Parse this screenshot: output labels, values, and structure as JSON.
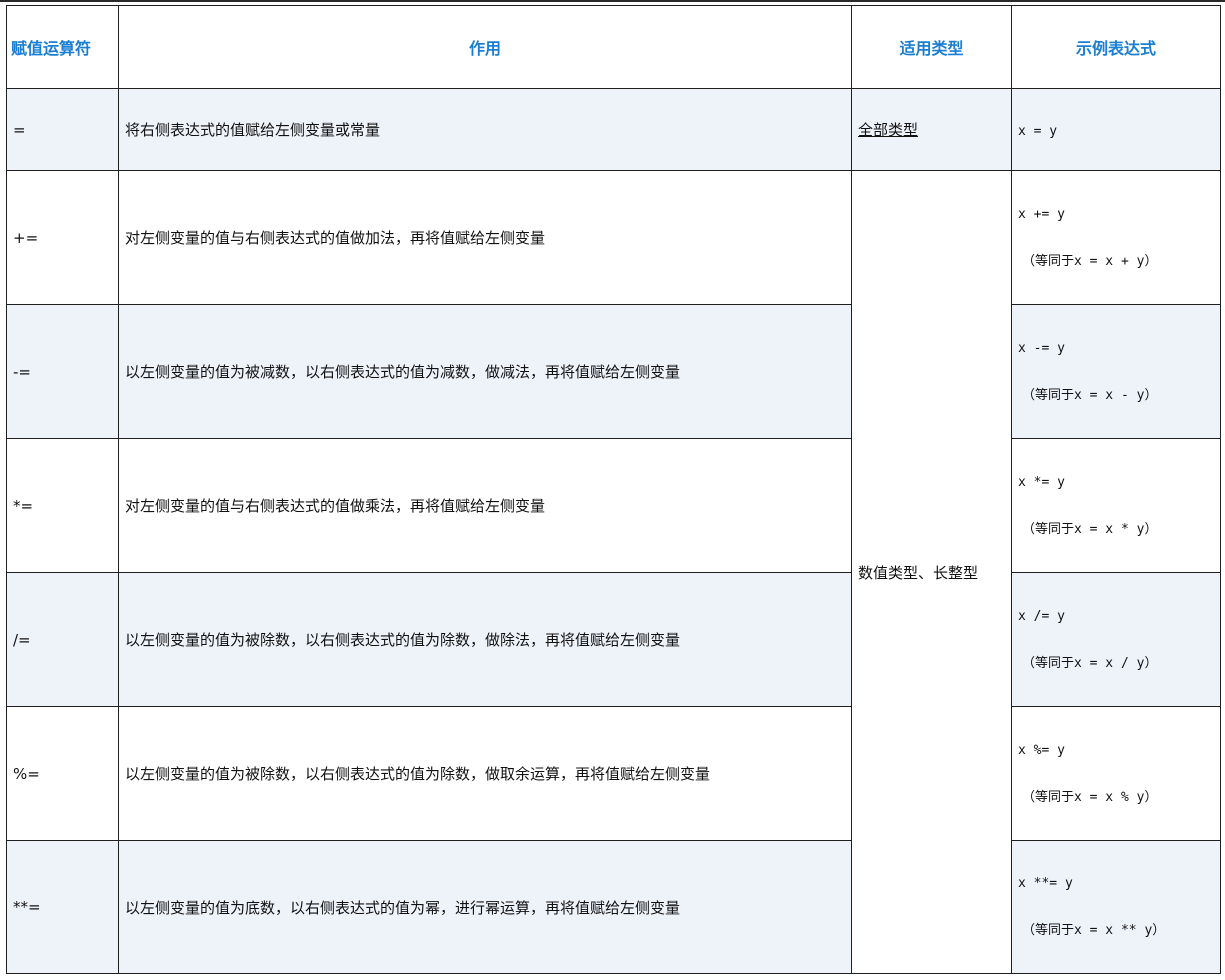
{
  "headers": [
    "赋值运算符",
    "作用",
    "适用类型",
    "示例表达式"
  ],
  "rows": [
    {
      "op": "=",
      "desc": "将右侧表达式的值赋给左侧变量或常量",
      "type": "全部类型",
      "ex1": "x = y",
      "ex2": ""
    },
    {
      "op": "+=",
      "desc": "对左侧变量的值与右侧表达式的值做加法，再将值赋给左侧变量",
      "ex1": "x += y",
      "ex2": "（等同于x = x + y）"
    },
    {
      "op": "-=",
      "desc": "以左侧变量的值为被减数，以右侧表达式的值为减数，做减法，再将值赋给左侧变量",
      "ex1": "x -= y",
      "ex2": "（等同于x = x - y）"
    },
    {
      "op": "*=",
      "desc": "对左侧变量的值与右侧表达式的值做乘法，再将值赋给左侧变量",
      "ex1": "x *= y",
      "ex2": "（等同于x = x * y）"
    },
    {
      "op": "/=",
      "desc": "以左侧变量的值为被除数，以右侧表达式的值为除数，做除法，再将值赋给左侧变量",
      "ex1": "x /= y",
      "ex2": "（等同于x = x / y）"
    },
    {
      "op": "%=",
      "desc": "以左侧变量的值为被除数，以右侧表达式的值为除数，做取余运算，再将值赋给左侧变量",
      "ex1": "x %= y",
      "ex2": "（等同于x = x % y）"
    },
    {
      "op": "**=",
      "desc": "以左侧变量的值为底数，以右侧表达式的值为幂，进行幂运算，再将值赋给左侧变量",
      "ex1": "x **= y",
      "ex2": "（等同于x = x ** y）"
    }
  ],
  "shared_type": "数值类型、长整型",
  "colors": {
    "header_text": "#1a7fd4",
    "shade_row": "#eef2f9",
    "border": "#1f1f1f"
  }
}
